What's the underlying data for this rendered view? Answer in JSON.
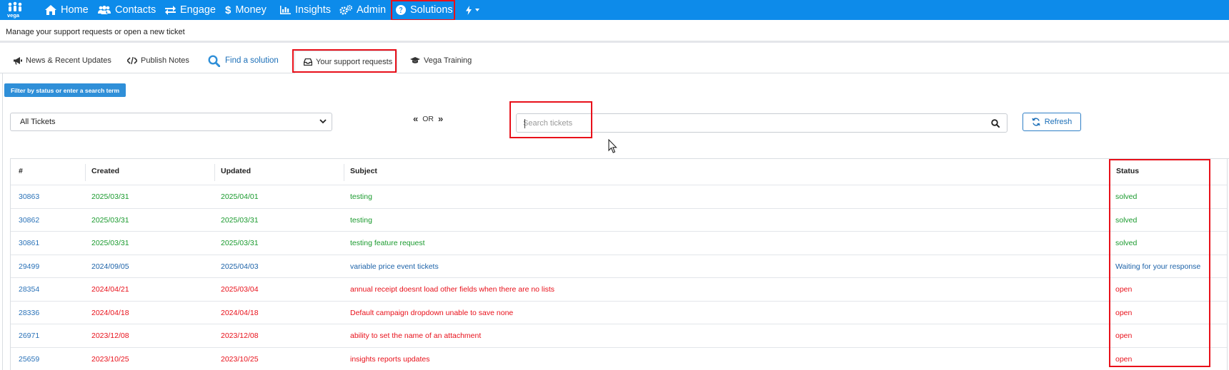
{
  "nav": {
    "logo_label": "vega",
    "items": [
      {
        "label": "Home",
        "icon": "home-icon"
      },
      {
        "label": "Contacts",
        "icon": "users-icon"
      },
      {
        "label": "Engage",
        "icon": "exchange-icon"
      },
      {
        "label": "Money",
        "icon": "dollar-icon"
      },
      {
        "label": "Insights",
        "icon": "bar-chart-icon"
      },
      {
        "label": "Admin",
        "icon": "cogs-icon"
      },
      {
        "label": "Solutions",
        "icon": "question-circle-icon"
      },
      {
        "label": "",
        "icon": "bolt-icon"
      }
    ],
    "color": "#0d8bea"
  },
  "subheader": {
    "text": "Manage your support requests or open a new ticket"
  },
  "tabs": [
    {
      "label": "News & Recent Updates",
      "icon": "bullhorn-icon"
    },
    {
      "label": "Publish Notes",
      "icon": "code-icon"
    },
    {
      "label": "Find a solution",
      "icon": "search-icon"
    },
    {
      "label": "Your support requests",
      "icon": "inbox-icon"
    },
    {
      "label": "Vega Training",
      "icon": "graduation-cap-icon"
    }
  ],
  "filter": {
    "badge": "Filter by status or enter a search term",
    "selected": "All Tickets",
    "or_label": "OR",
    "search_placeholder": "Search tickets",
    "search_value": "",
    "refresh_label": "Refresh"
  },
  "table": {
    "headers": [
      "#",
      "Created",
      "Updated",
      "Subject",
      "Status"
    ],
    "rows": [
      {
        "id": "30863",
        "created": "2025/03/31",
        "updated": "2025/04/01",
        "subject": "testing",
        "status": "solved"
      },
      {
        "id": "30862",
        "created": "2025/03/31",
        "updated": "2025/03/31",
        "subject": "testing",
        "status": "solved"
      },
      {
        "id": "30861",
        "created": "2025/03/31",
        "updated": "2025/03/31",
        "subject": "testing feature request",
        "status": "solved"
      },
      {
        "id": "29499",
        "created": "2024/09/05",
        "updated": "2025/04/03",
        "subject": "variable price event tickets",
        "status": "Waiting for your response"
      },
      {
        "id": "28354",
        "created": "2024/04/21",
        "updated": "2025/03/04",
        "subject": "annual receipt doesnt load other fields when there are no lists",
        "status": "open"
      },
      {
        "id": "28336",
        "created": "2024/04/18",
        "updated": "2024/04/18",
        "subject": "Default campaign dropdown unable to save none",
        "status": "open"
      },
      {
        "id": "26971",
        "created": "2023/12/08",
        "updated": "2023/12/08",
        "subject": "ability to set the name of an attachment",
        "status": "open"
      },
      {
        "id": "25659",
        "created": "2023/10/25",
        "updated": "2023/10/25",
        "subject": "insights reports updates",
        "status": "open"
      }
    ]
  },
  "status_colors": {
    "solved": "#1a9a2e",
    "Waiting for your response": "#1c62a8",
    "open": "#e8101a"
  },
  "highlight_color": "#e8101a"
}
